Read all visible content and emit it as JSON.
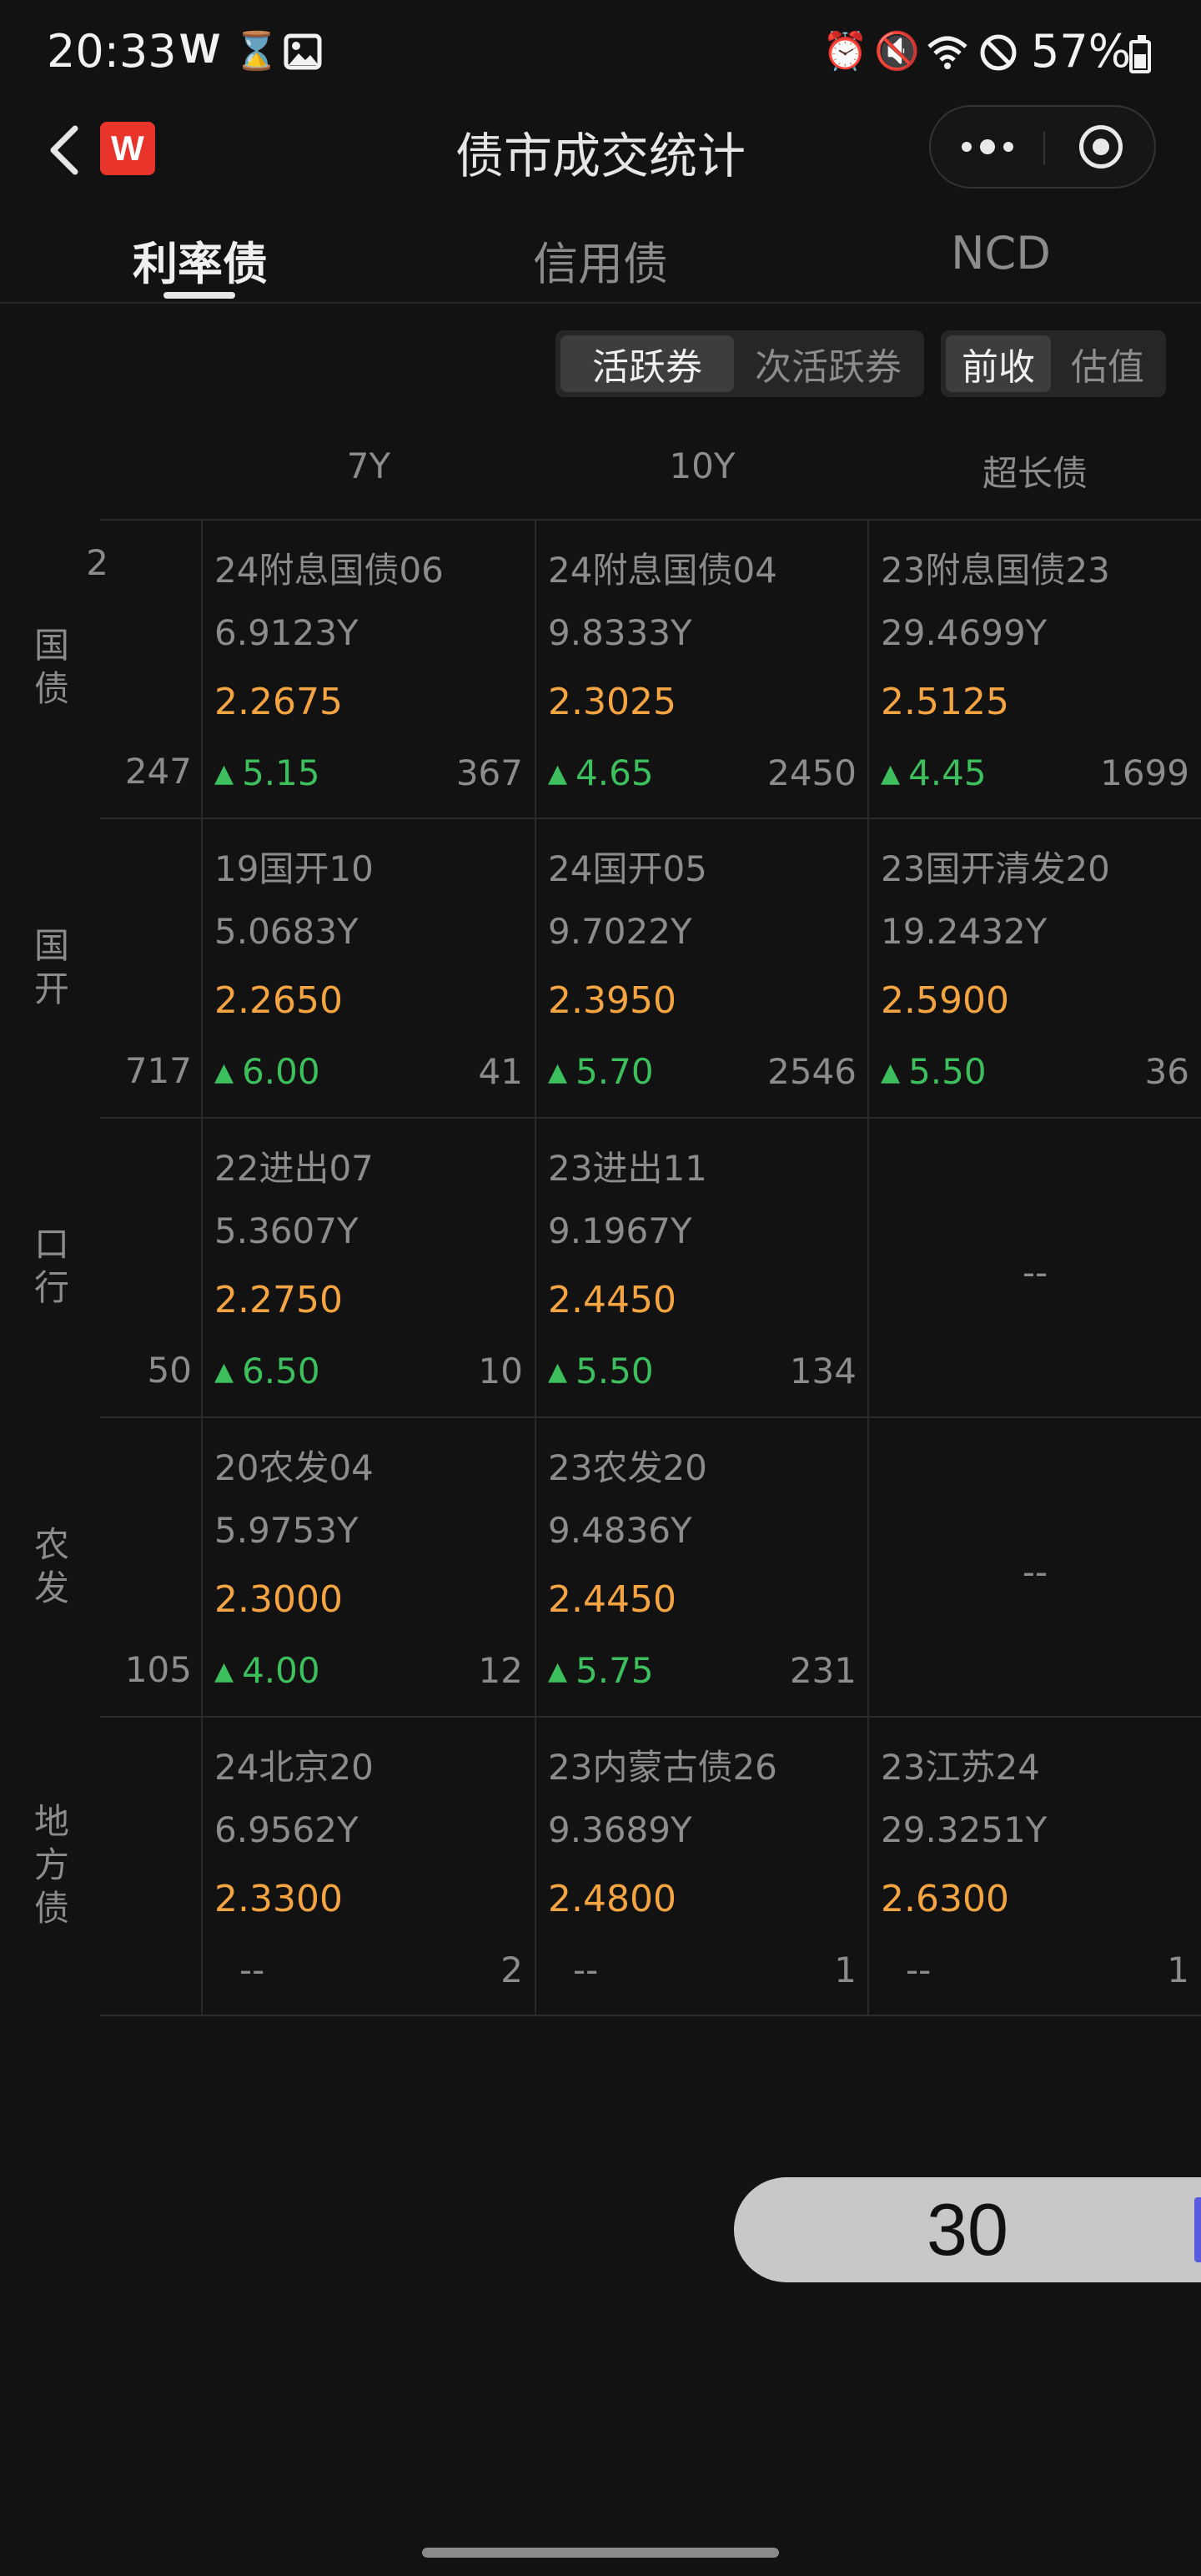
{
  "status_bar": {
    "time": "20:33",
    "app_glyph": "W",
    "battery": "57%",
    "icons": [
      "hourglass-icon",
      "image-icon",
      "alarm-icon",
      "mute-icon",
      "wifi-icon",
      "no-disturb-icon",
      "battery-icon"
    ]
  },
  "header": {
    "title": "债市成交统计",
    "logo_text": "W",
    "accent": "#e8342b"
  },
  "tabs": [
    {
      "label": "利率债",
      "active": true
    },
    {
      "label": "信用债",
      "active": false
    },
    {
      "label": "NCD",
      "active": false
    }
  ],
  "filters": {
    "bond_type": {
      "options": [
        "活跃券",
        "次活跃券"
      ],
      "selected": "活跃券"
    },
    "price_mode": {
      "options": [
        "前收",
        "估值"
      ],
      "selected": "前收"
    }
  },
  "columns": [
    "7Y",
    "10Y",
    "超长债"
  ],
  "rows": [
    {
      "label": "国债",
      "partial": {
        "top": "2",
        "bottom": "247"
      },
      "cells": [
        {
          "name": "24附息国债06",
          "term": "6.9123Y",
          "yield": "2.2675",
          "change": "5.15",
          "volume": "367"
        },
        {
          "name": "24附息国债04",
          "term": "9.8333Y",
          "yield": "2.3025",
          "change": "4.65",
          "volume": "2450"
        },
        {
          "name": "23附息国债23",
          "term": "29.4699Y",
          "yield": "2.5125",
          "change": "4.45",
          "volume": "1699"
        }
      ]
    },
    {
      "label": "国开",
      "partial": {
        "top": "",
        "bottom": "717"
      },
      "cells": [
        {
          "name": "19国开10",
          "term": "5.0683Y",
          "yield": "2.2650",
          "change": "6.00",
          "volume": "41"
        },
        {
          "name": "24国开05",
          "term": "9.7022Y",
          "yield": "2.3950",
          "change": "5.70",
          "volume": "2546"
        },
        {
          "name": "23国开清发20",
          "term": "19.2432Y",
          "yield": "2.5900",
          "change": "5.50",
          "volume": "36"
        }
      ]
    },
    {
      "label": "口行",
      "partial": {
        "top": "",
        "bottom": "50"
      },
      "cells": [
        {
          "name": "22进出07",
          "term": "5.3607Y",
          "yield": "2.2750",
          "change": "6.50",
          "volume": "10"
        },
        {
          "name": "23进出11",
          "term": "9.1967Y",
          "yield": "2.4450",
          "change": "5.50",
          "volume": "134"
        },
        {
          "empty": true,
          "placeholder": "--"
        }
      ]
    },
    {
      "label": "农发",
      "partial": {
        "top": "",
        "bottom": "105"
      },
      "cells": [
        {
          "name": "20农发04",
          "term": "5.9753Y",
          "yield": "2.3000",
          "change": "4.00",
          "volume": "12"
        },
        {
          "name": "23农发20",
          "term": "9.4836Y",
          "yield": "2.4450",
          "change": "5.75",
          "volume": "231"
        },
        {
          "empty": true,
          "placeholder": "--"
        }
      ]
    },
    {
      "label": "地方债",
      "partial": {
        "top": "",
        "bottom": ""
      },
      "cells": [
        {
          "name": "24北京20",
          "term": "6.9562Y",
          "yield": "2.3300",
          "change_text": "--",
          "volume": "2"
        },
        {
          "name": "23内蒙古债26",
          "term": "9.3689Y",
          "yield": "2.4800",
          "change_text": "--",
          "volume": "1"
        },
        {
          "name": "23江苏24",
          "term": "29.3251Y",
          "yield": "2.6300",
          "change_text": "--",
          "volume": "1"
        }
      ]
    }
  ],
  "page_badge": "30",
  "colors": {
    "background": "#121212",
    "yield": "#f5a442",
    "change_up": "#3cbf5c",
    "muted": "#8c8c8c"
  }
}
